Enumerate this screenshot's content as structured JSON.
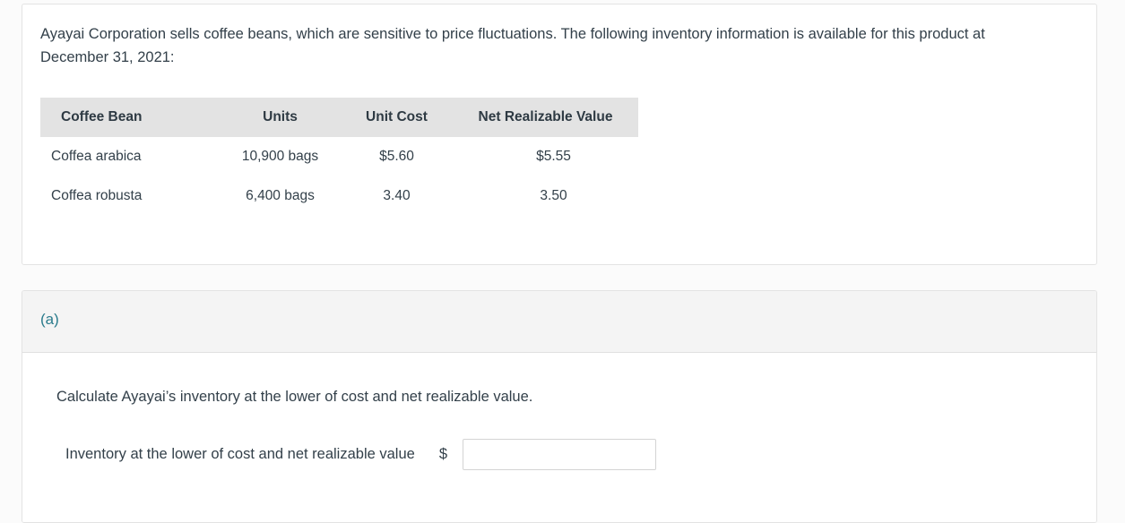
{
  "problem": {
    "intro": "Ayayai Corporation sells coffee beans, which are sensitive to price fluctuations. The following inventory information is available for this product at December 31, 2021:",
    "table": {
      "headers": [
        "Coffee Bean",
        "Units",
        "Unit Cost",
        "Net Realizable Value"
      ],
      "rows": [
        {
          "bean": "Coffea arabica",
          "units": "10,900 bags",
          "unit_cost": "$5.60",
          "nrv": "$5.55"
        },
        {
          "bean": "Coffea robusta",
          "units": "6,400 bags",
          "unit_cost": "3.40",
          "nrv": "3.50"
        }
      ]
    }
  },
  "question": {
    "part_label": "(a)",
    "prompt": "Calculate Ayayai’s inventory at the lower of cost and net realizable value.",
    "answer_label": "Inventory at the lower of cost and net realizable value",
    "currency_symbol": "$",
    "answer_value": "",
    "answer_placeholder": ""
  },
  "colors": {
    "accent": "#2a7b8c",
    "table_header_bg": "#e3e3e3",
    "section_header_bg": "#f4f4f4",
    "text": "#33404a"
  }
}
